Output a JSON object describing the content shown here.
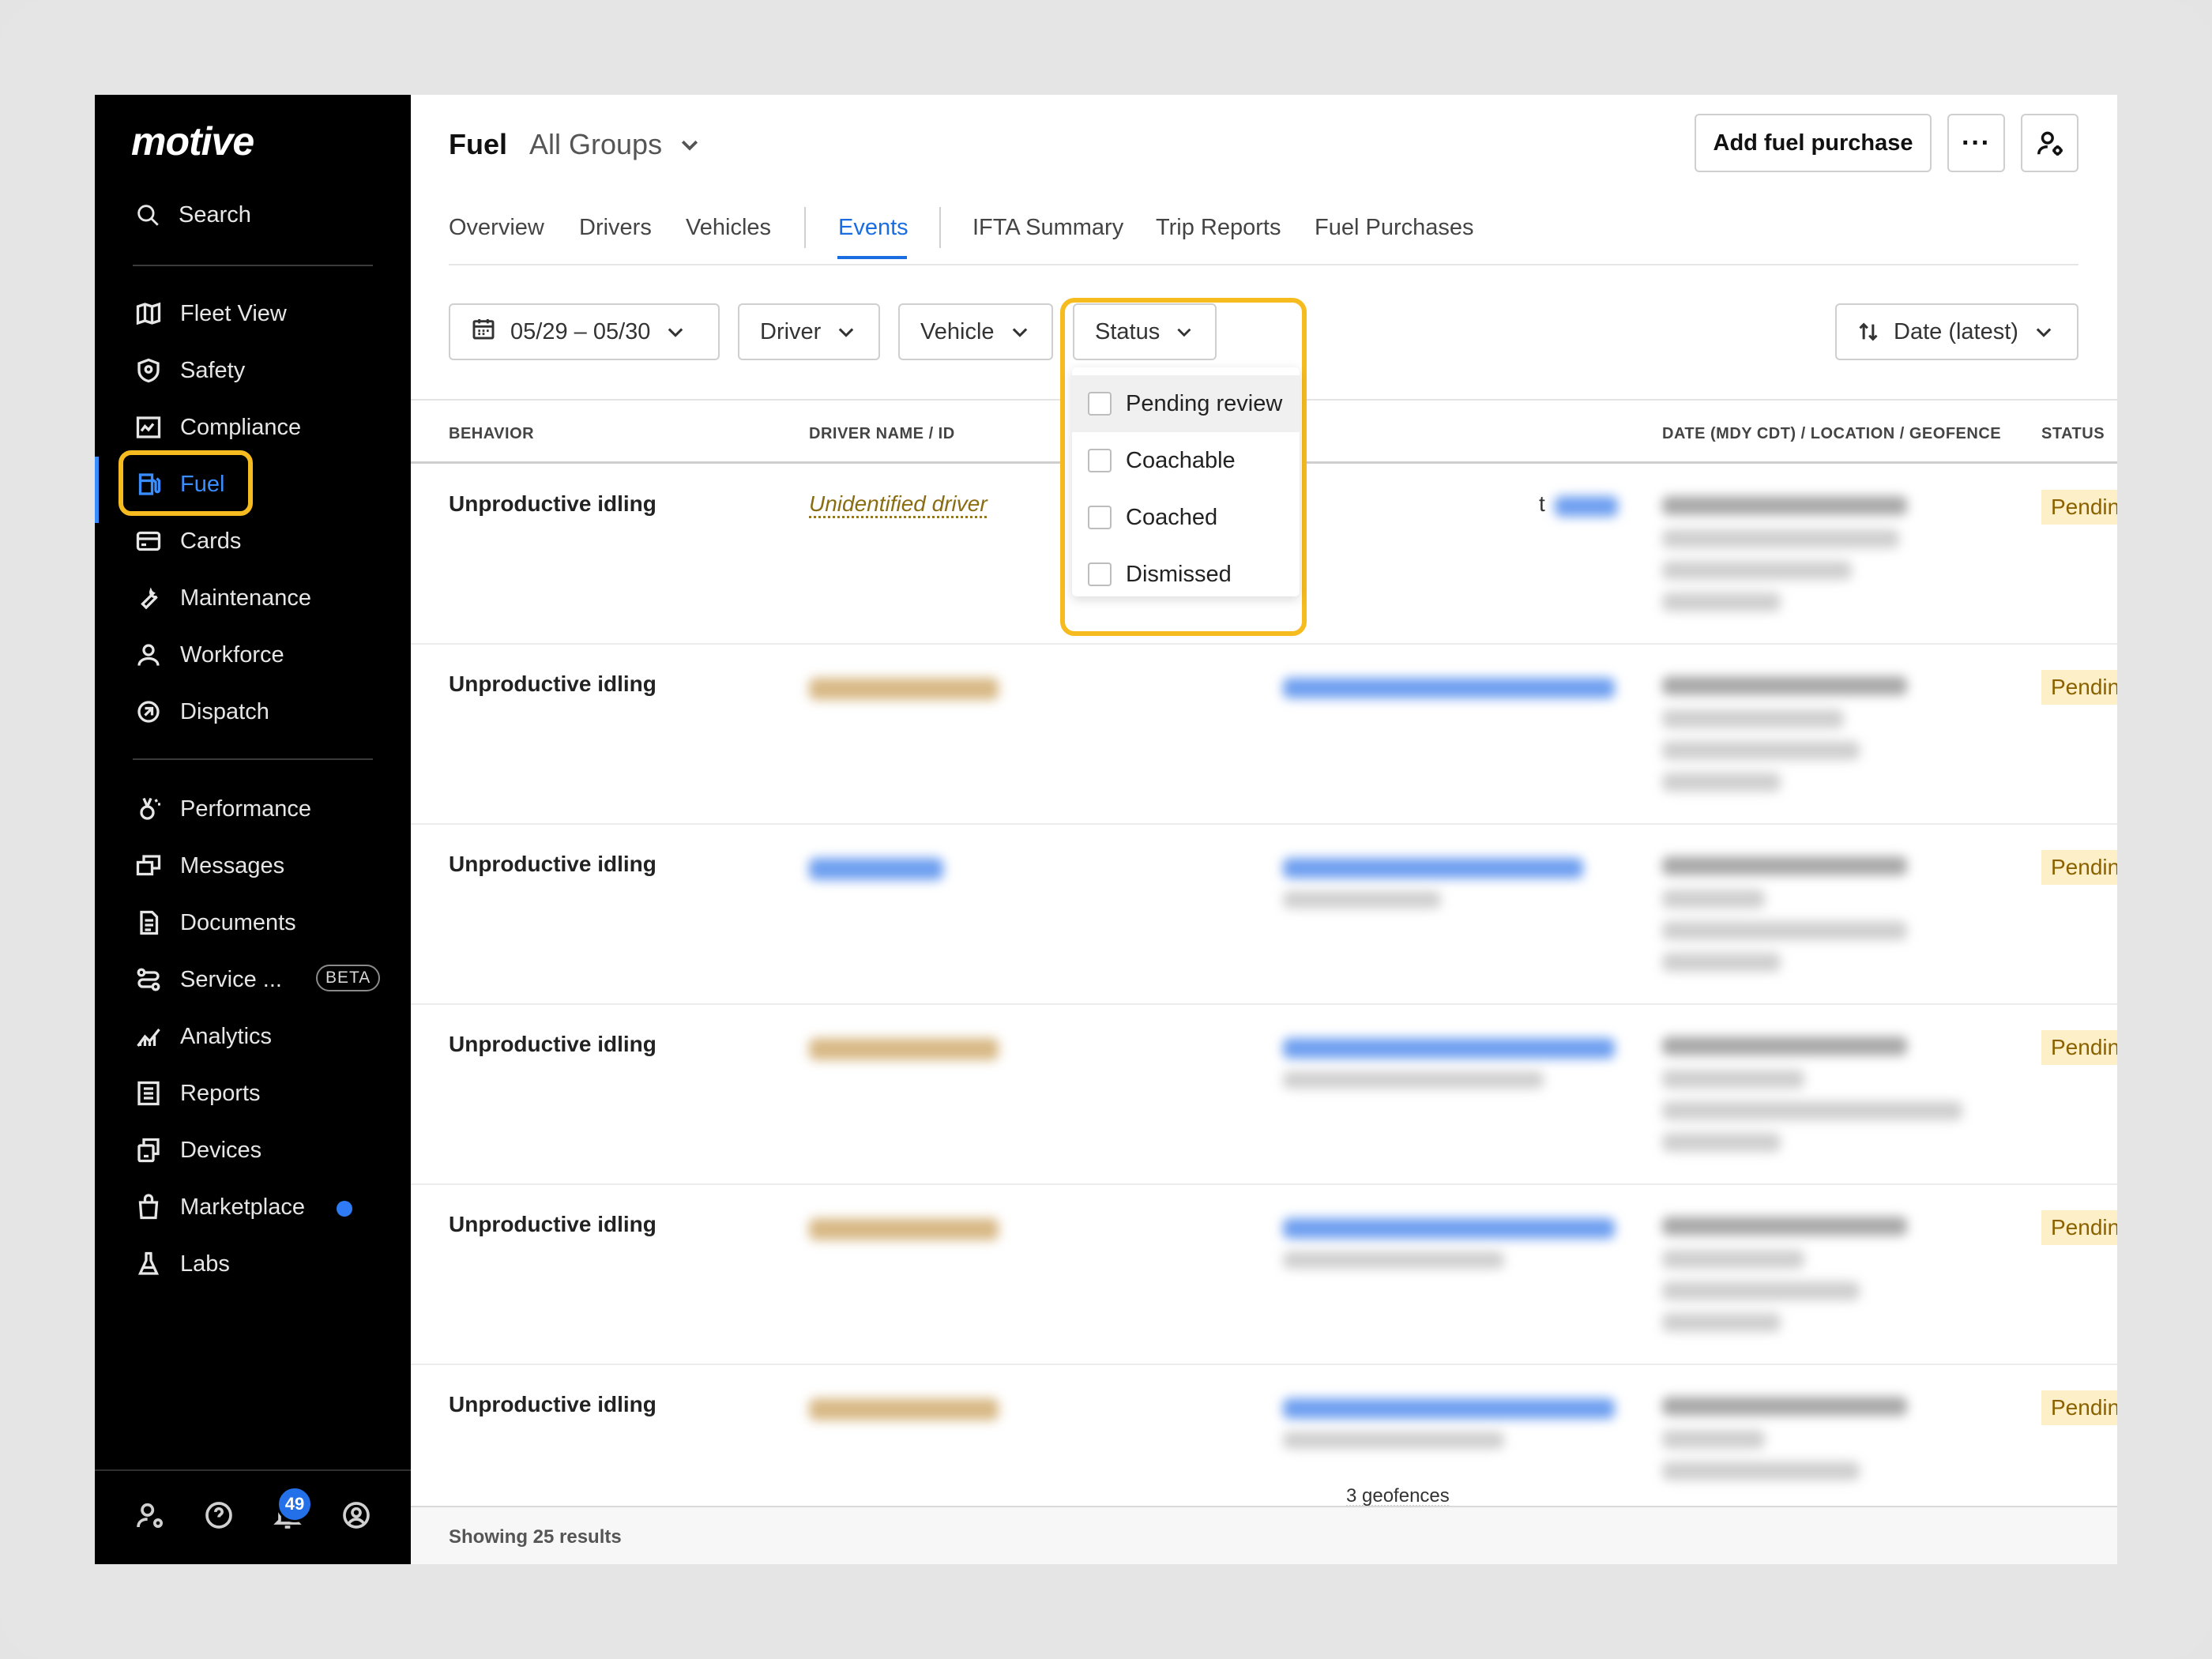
{
  "brand": {
    "logo": "motive"
  },
  "sidebar": {
    "search_label": "Search",
    "items": [
      {
        "label": "Fleet View",
        "icon": "map-icon"
      },
      {
        "label": "Safety",
        "icon": "shield-icon"
      },
      {
        "label": "Compliance",
        "icon": "compliance-icon"
      },
      {
        "label": "Fuel",
        "icon": "fuel-icon",
        "active": true
      },
      {
        "label": "Cards",
        "icon": "card-icon"
      },
      {
        "label": "Maintenance",
        "icon": "wrench-icon"
      },
      {
        "label": "Workforce",
        "icon": "person-icon"
      },
      {
        "label": "Dispatch",
        "icon": "dispatch-icon"
      },
      {
        "label": "Performance",
        "icon": "medal-icon"
      },
      {
        "label": "Messages",
        "icon": "messages-icon"
      },
      {
        "label": "Documents",
        "icon": "document-icon"
      },
      {
        "label": "Service ...",
        "icon": "route-icon",
        "badge": "BETA"
      },
      {
        "label": "Analytics",
        "icon": "analytics-icon"
      },
      {
        "label": "Reports",
        "icon": "reports-icon"
      },
      {
        "label": "Devices",
        "icon": "devices-icon"
      },
      {
        "label": "Marketplace",
        "icon": "bag-icon",
        "dot": true
      },
      {
        "label": "Labs",
        "icon": "flask-icon"
      }
    ],
    "notification_count": "49"
  },
  "header": {
    "title": "Fuel",
    "group": "All Groups",
    "add_button": "Add fuel purchase",
    "more_button": "···"
  },
  "tabs": [
    "Overview",
    "Drivers",
    "Vehicles",
    "Events",
    "IFTA Summary",
    "Trip Reports",
    "Fuel Purchases"
  ],
  "filters": {
    "date": "05/29 – 05/30",
    "driver": "Driver",
    "vehicle": "Vehicle",
    "status": "Status",
    "sort": "Date (latest)"
  },
  "status_dropdown": {
    "options": [
      "Pending review",
      "Coachable",
      "Coached",
      "Dismissed"
    ]
  },
  "table": {
    "columns": [
      "BEHAVIOR",
      "DRIVER NAME / ID",
      "DATE (MDY CDT) / LOCATION / GEOFENCE",
      "STATUS"
    ],
    "rows": [
      {
        "behavior": "Unproductive idling",
        "driver": "Unidentified driver",
        "status": "Pending review"
      },
      {
        "behavior": "Unproductive idling",
        "status": "Pending review"
      },
      {
        "behavior": "Unproductive idling",
        "status": "Pending review"
      },
      {
        "behavior": "Unproductive idling",
        "status": "Pending review"
      },
      {
        "behavior": "Unproductive idling",
        "status": "Pending review"
      },
      {
        "behavior": "Unproductive idling",
        "status": "Pending review",
        "geofences": "3 geofences"
      }
    ],
    "partial_text": "t"
  },
  "footer": {
    "results": "Showing 25 results"
  },
  "colors": {
    "accent": "#1a6de0",
    "highlight": "#f6bb1f",
    "pending_bg": "#fdf0c9",
    "pending_text": "#8b6100"
  }
}
